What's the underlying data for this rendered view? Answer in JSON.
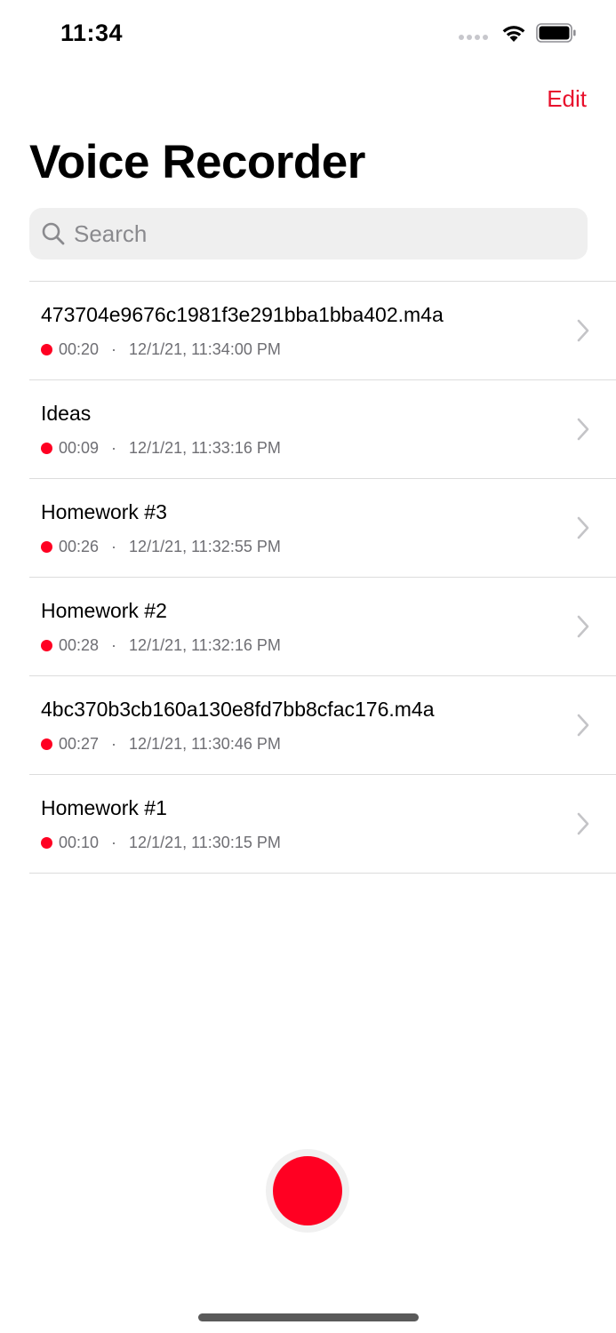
{
  "status_bar": {
    "time": "11:34"
  },
  "nav": {
    "edit_label": "Edit"
  },
  "page": {
    "title": "Voice Recorder"
  },
  "search": {
    "placeholder": "Search",
    "value": ""
  },
  "recordings": [
    {
      "title": "473704e9676c1981f3e291bba1bba402.m4a",
      "duration": "00:20",
      "separator": "·",
      "timestamp": "12/1/21, 11:34:00 PM"
    },
    {
      "title": "Ideas",
      "duration": "00:09",
      "separator": "·",
      "timestamp": "12/1/21, 11:33:16 PM"
    },
    {
      "title": "Homework #3",
      "duration": "00:26",
      "separator": "·",
      "timestamp": "12/1/21, 11:32:55 PM"
    },
    {
      "title": "Homework #2",
      "duration": "00:28",
      "separator": "·",
      "timestamp": "12/1/21, 11:32:16 PM"
    },
    {
      "title": "4bc370b3cb160a130e8fd7bb8cfac176.m4a",
      "duration": "00:27",
      "separator": "·",
      "timestamp": "12/1/21, 11:30:46 PM"
    },
    {
      "title": "Homework #1",
      "duration": "00:10",
      "separator": "·",
      "timestamp": "12/1/21, 11:30:15 PM"
    }
  ],
  "colors": {
    "accent": "#e8112d",
    "record": "#ff0022",
    "chevron": "#c4c4c7"
  },
  "icons": {
    "search": "search-icon",
    "chevron": "chevron-right-icon",
    "wifi": "wifi-icon",
    "battery": "battery-icon",
    "signal": "cellular-signal-icon",
    "record": "record-dot-icon"
  }
}
